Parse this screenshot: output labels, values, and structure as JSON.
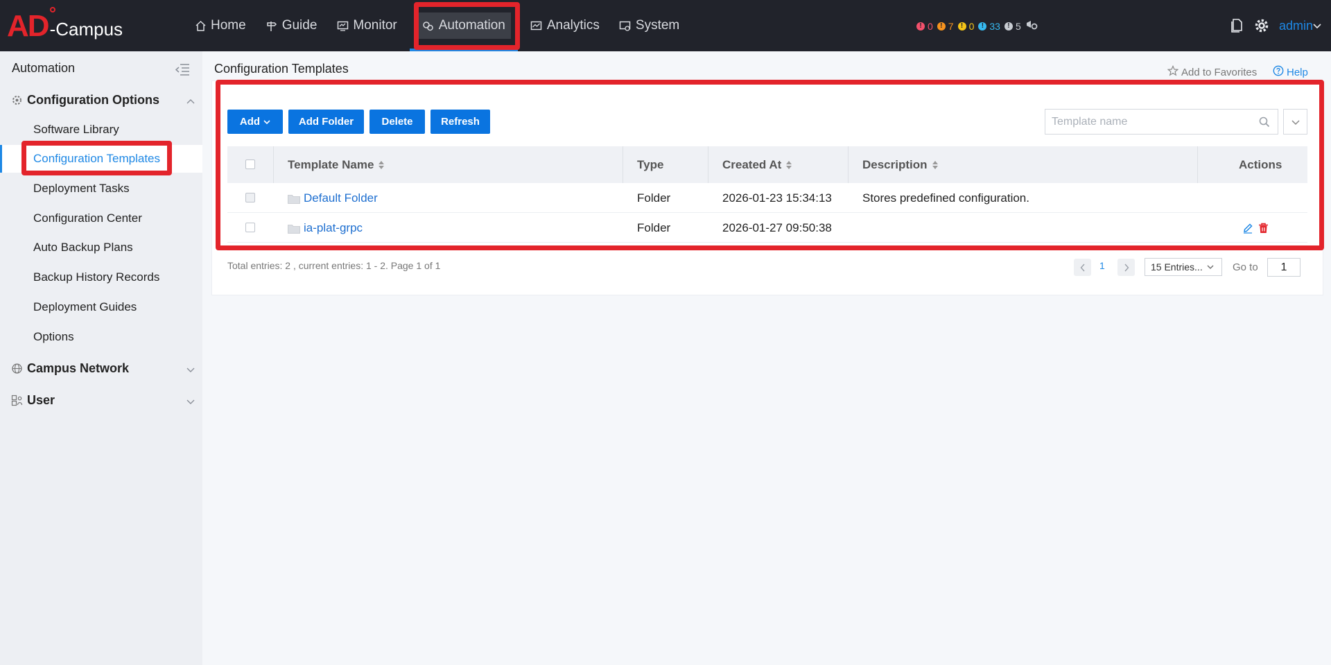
{
  "brand": {
    "logo_mark": "AD",
    "logo_text": "-Campus"
  },
  "nav": {
    "items": [
      {
        "label": "Home",
        "icon": "home-icon"
      },
      {
        "label": "Guide",
        "icon": "signpost-icon"
      },
      {
        "label": "Monitor",
        "icon": "monitor-icon"
      },
      {
        "label": "Automation",
        "icon": "automation-icon",
        "active": true
      },
      {
        "label": "Analytics",
        "icon": "analytics-icon"
      },
      {
        "label": "System",
        "icon": "system-icon"
      }
    ]
  },
  "alarms": [
    {
      "count": "0",
      "color": "#f4516c"
    },
    {
      "count": "7",
      "color": "#f7931e"
    },
    {
      "count": "0",
      "color": "#f5c518"
    },
    {
      "count": "33",
      "color": "#36b9f0"
    },
    {
      "count": "5",
      "color": "#c8ccd2"
    }
  ],
  "top_right": {
    "user": "admin"
  },
  "sidebar": {
    "title": "Automation",
    "groups": [
      {
        "label": "Configuration Options",
        "expanded": true,
        "items": [
          "Software Library",
          "Configuration Templates",
          "Deployment Tasks",
          "Configuration Center",
          "Auto Backup Plans",
          "Backup History Records",
          "Deployment Guides",
          "Options"
        ],
        "active_item": "Configuration Templates"
      },
      {
        "label": "Campus Network",
        "expanded": false
      },
      {
        "label": "User",
        "expanded": false
      }
    ]
  },
  "page": {
    "title": "Configuration Templates",
    "add_to_favorites": "Add to Favorites",
    "help": "Help"
  },
  "toolbar": {
    "add": "Add",
    "add_folder": "Add Folder",
    "delete": "Delete",
    "refresh": "Refresh",
    "search_placeholder": "Template name"
  },
  "table": {
    "columns": [
      "Template Name",
      "Type",
      "Created At",
      "Description",
      "Actions"
    ],
    "rows": [
      {
        "name": "Default Folder",
        "type": "Folder",
        "created": "2026-01-23 15:34:13",
        "description": "Stores predefined configuration.",
        "has_actions": false
      },
      {
        "name": "ia-plat-grpc",
        "type": "Folder",
        "created": "2026-01-27 09:50:38",
        "description": "",
        "has_actions": true
      }
    ]
  },
  "pagination": {
    "summary": "Total entries: 2 , current entries: 1 - 2. Page 1 of 1",
    "current_page": "1",
    "page_size": "15 Entries...",
    "goto_label": "Go to",
    "goto_value": "1"
  },
  "colors": {
    "accent": "#0a74e0",
    "highlight": "#e3242b",
    "topbar": "#21232b"
  }
}
